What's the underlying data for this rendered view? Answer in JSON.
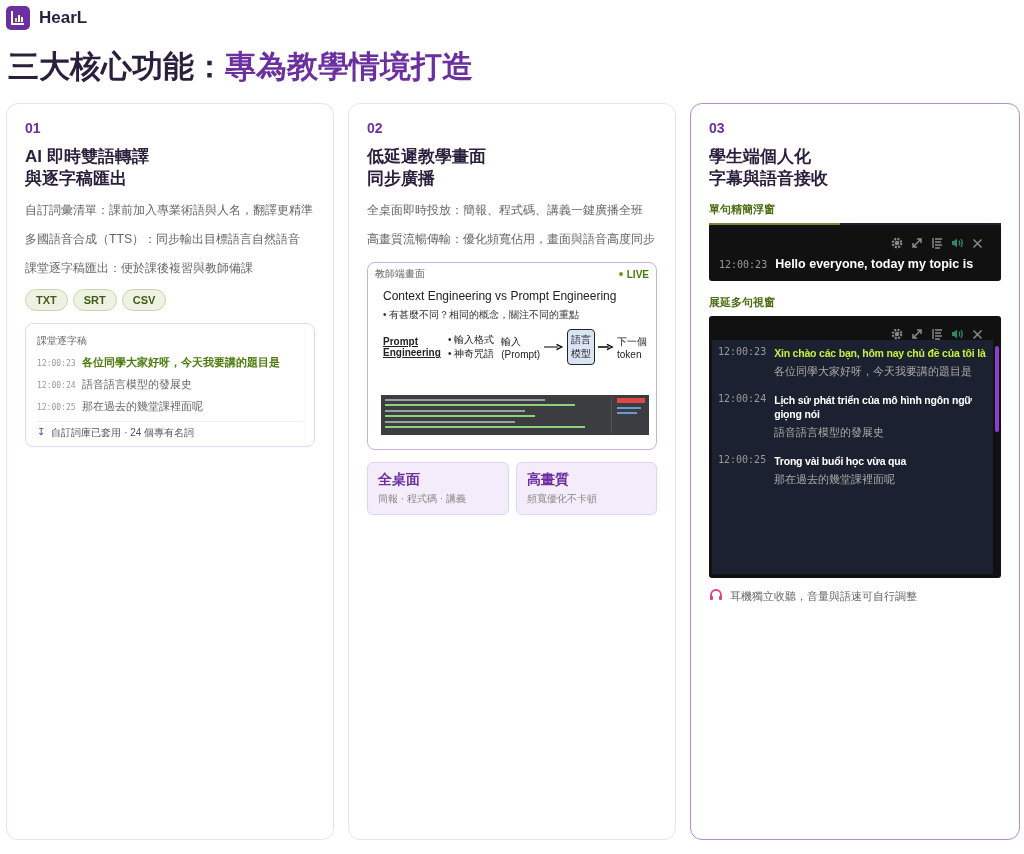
{
  "app": {
    "name": "HearL"
  },
  "heading": {
    "lead": "三大核心功能：",
    "highlight": "專為教學情境打造"
  },
  "cards": [
    {
      "kind": "transcript",
      "number": "01",
      "selected": false,
      "title_lines": [
        "AI 即時雙語轉譯",
        "與逐字稿匯出"
      ],
      "bullets": [
        "自訂詞彙清單：課前加入專業術語與人名，翻譯更精準",
        "多國語音合成（TTS）：同步輸出目標語言自然語音",
        "課堂逐字稿匯出：便於課後複習與教師備課"
      ],
      "formats": [
        "TXT",
        "SRT",
        "CSV"
      ],
      "transcript": {
        "title": "課堂逐字稿",
        "lines": [
          {
            "time": "12:00:23",
            "text": "各位同學大家好呀，今天我要講的題目是",
            "highlighted": true
          },
          {
            "time": "12:00:24",
            "text": "語音語言模型的發展史",
            "highlighted": false
          },
          {
            "time": "12:00:25",
            "text": "那在過去的幾堂課裡面呢",
            "highlighted": false
          }
        ],
        "footer_icon": "↧",
        "footer": "自訂詞庫已套用 · 24 個專有名詞"
      }
    },
    {
      "kind": "broadcast",
      "number": "02",
      "selected": false,
      "title_lines": [
        "低延遲教學畫面",
        "同步廣播"
      ],
      "bullets": [
        "全桌面即時投放：簡報、程式碼、講義一鍵廣播全班",
        "高畫質流暢傳輸：優化頻寬佔用，畫面與語音高度同步"
      ],
      "preview": {
        "label": "教師端畫面",
        "live": "LIVE",
        "slide": {
          "title": "Context Engineering vs Prompt Engineering",
          "bullet": "• 有甚麼不同？相同的概念，關注不同的重點",
          "prompt_label": "Prompt Engineering",
          "prompt_items": [
            "• 輸入格式",
            "• 神奇咒語"
          ],
          "input_label": "輸入 (Prompt)",
          "model_label": "語言模型",
          "output_label": "下一個 token"
        }
      },
      "features": [
        {
          "title": "全桌面",
          "subtitle": "簡報 · 程式碼 · 講義"
        },
        {
          "title": "高畫質",
          "subtitle": "頻寬優化不卡頓"
        }
      ]
    },
    {
      "kind": "student",
      "number": "03",
      "selected": true,
      "title_lines": [
        "學生端個人化",
        "字幕與語音接收"
      ],
      "float_window": {
        "label": "單句精簡浮窗",
        "level": 0.45,
        "time": "12:00:23",
        "text": "Hello everyone, today my topic is"
      },
      "multi_window": {
        "label": "展延多句視窗",
        "lines": [
          {
            "time": "12:00:23",
            "translation": "Xin chào các bạn, hôm nay chủ đề của tôi là",
            "original": "各位同學大家好呀，今天我要講的題目是",
            "highlighted": true
          },
          {
            "time": "12:00:24",
            "translation": "Lịch sử phát triển của mô hình ngôn ngữ giọng nói",
            "original": "語音語言模型的發展史",
            "highlighted": false
          },
          {
            "time": "12:00:25",
            "translation": "Trong vài buổi học vừa qua",
            "original": "那在過去的幾堂課裡面呢",
            "highlighted": false
          }
        ]
      },
      "note": "耳機獨立收聽，音量與語速可自行調整"
    }
  ]
}
